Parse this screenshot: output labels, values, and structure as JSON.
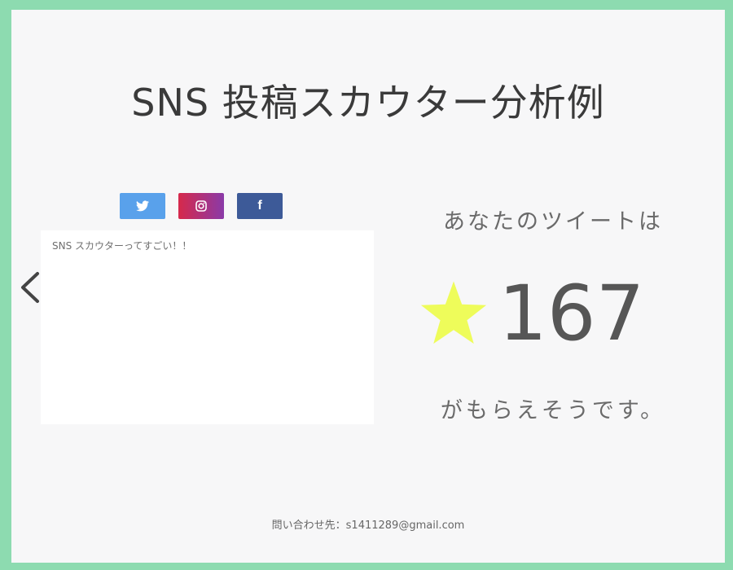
{
  "title": "SNS 投稿スカウター分析例",
  "social_buttons": [
    {
      "icon": "twitter-icon",
      "color": "#59a1eb"
    },
    {
      "icon": "instagram-icon",
      "color": "#c72f77"
    },
    {
      "icon": "facebook-icon",
      "color": "#3d5a98",
      "glyph": "f"
    }
  ],
  "tweet": {
    "text": "SNS スカウターってすごい！！"
  },
  "result": {
    "prefix": "あなたのツイートは",
    "score": "167",
    "suffix": "がもらえそうです。",
    "star_color": "#eefc5a"
  },
  "footer": {
    "contact": "問い合わせ先：s1411289@gmail.com"
  }
}
